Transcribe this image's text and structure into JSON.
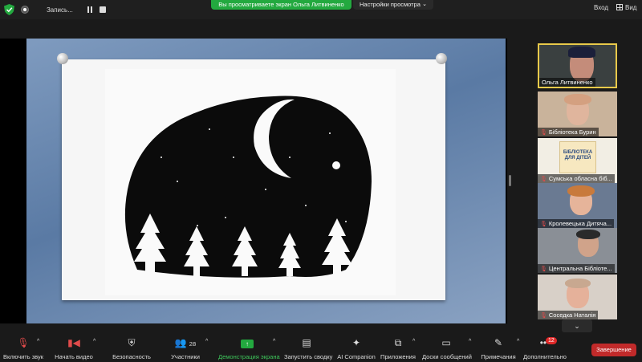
{
  "topbar": {
    "recording_label": "Запись...",
    "viewing_banner": "Вы просматриваете экран Ольга Литвиненко",
    "view_settings_label": "Настройки просмотра",
    "enter_label": "Вход",
    "view_label": "Вид"
  },
  "gallery": {
    "participants": [
      {
        "name": "Ольга Литвиненко"
      },
      {
        "name": "Бібліотека Бурин"
      },
      {
        "name": "Сумська обласна біб..."
      },
      {
        "name": "Кролевецька Дитяча..."
      },
      {
        "name": "Центральна Бібліоте..."
      },
      {
        "name": "Соседка Наталія"
      }
    ],
    "book_cover_text": "БІБЛІОТЕКА ДЛЯ ДІТЕЙ"
  },
  "toolbar": {
    "unmute_label": "Включить звук",
    "video_label": "Начать видео",
    "security_label": "Безопасность",
    "participants_label": "Участники",
    "participants_count": "28",
    "share_label": "Демонстрация экрана",
    "summary_label": "Запустить сводку",
    "ai_label": "AI Companion",
    "apps_label": "Приложения",
    "whiteboard_label": "Доски сообщений",
    "notes_label": "Примечания",
    "more_label": "Дополнительно",
    "more_badge": "12",
    "end_label": "Завершение"
  },
  "colors": {
    "accent_green": "#23a93f",
    "end_red": "#c12a2a",
    "active_speaker": "#e8c94a"
  }
}
